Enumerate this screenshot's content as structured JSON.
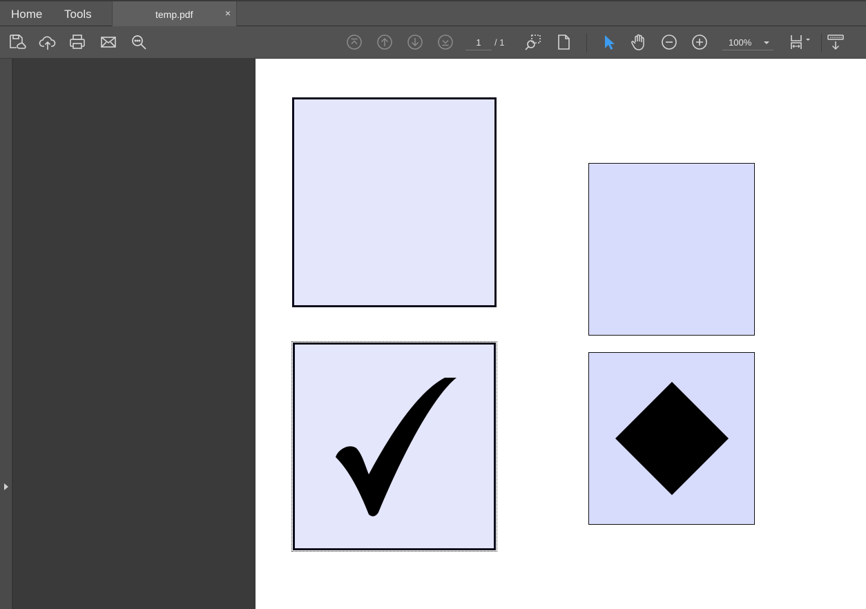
{
  "app": {
    "tabs": {
      "home": "Home",
      "tools": "Tools",
      "document": "temp.pdf",
      "close": "×"
    }
  },
  "toolbar": {
    "icons": {
      "save": "save-cloud-icon",
      "upload": "cloud-upload-icon",
      "print": "printer-icon",
      "email": "envelope-icon",
      "find": "magnifier-search-icon",
      "first_page": "first-page-icon",
      "prev_page": "previous-page-icon",
      "next_page": "next-page-icon",
      "last_page": "last-page-icon",
      "marquee_zoom": "marquee-zoom-icon",
      "page_view": "single-page-icon",
      "select": "select-cursor-icon",
      "hand": "hand-tool-icon",
      "zoom_out": "zoom-out-icon",
      "zoom_in": "zoom-in-icon",
      "page_fit": "page-fit-icon",
      "read_mode": "read-mode-icon"
    },
    "page": {
      "current": "1",
      "total": "/ 1"
    },
    "zoom": {
      "value": "100%"
    },
    "colors": {
      "select_active": "#3d9cf0"
    }
  },
  "document": {
    "form_fields": [
      {
        "type": "checkbox",
        "state": "unchecked",
        "fill": "#e4e6fc"
      },
      {
        "type": "checkbox",
        "state": "checked",
        "glyph": "check-mark-icon",
        "focused": true,
        "fill": "#e4e6fc"
      },
      {
        "type": "radio-box",
        "state": "unselected",
        "fill": "#d8dcfc"
      },
      {
        "type": "radio-box",
        "state": "selected",
        "glyph": "diamond-icon",
        "fill": "#d8dcfc"
      }
    ]
  }
}
